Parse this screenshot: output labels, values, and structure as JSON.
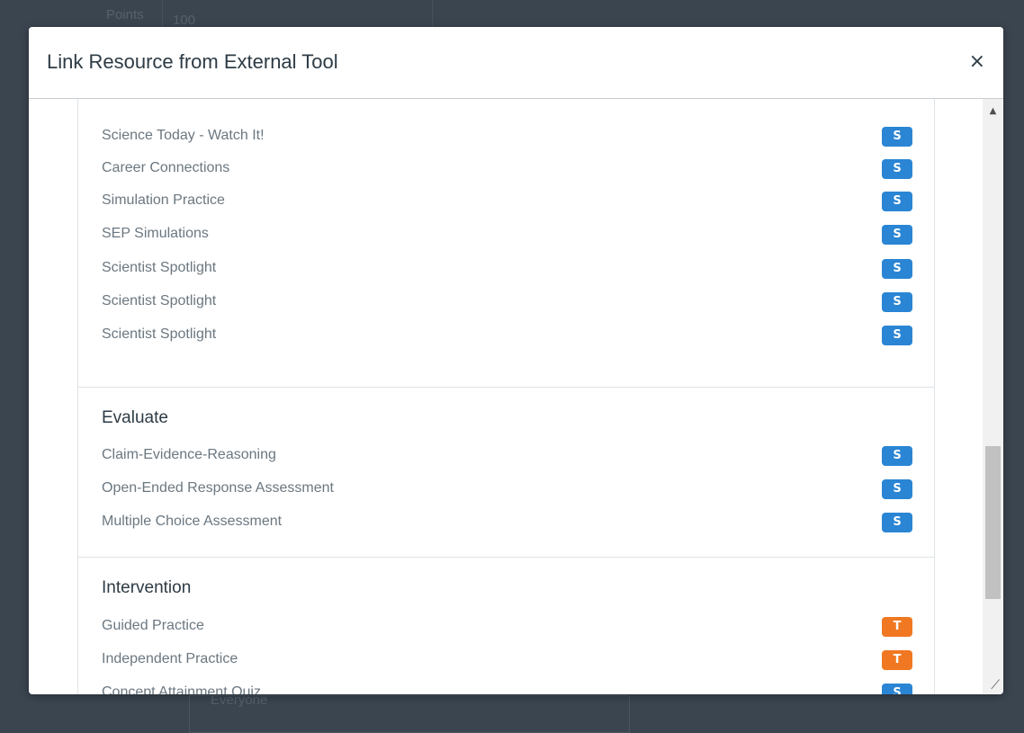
{
  "background": {
    "points_label": "Points",
    "points_value": "100",
    "assign_to_value": "Everyone"
  },
  "modal": {
    "title": "Link Resource from External Tool",
    "close_label": "×"
  },
  "colors": {
    "student_badge": "#2a85d4",
    "teacher_badge": "#f07822"
  },
  "list": {
    "top_items": [
      {
        "label": "Science Today - Watch It!",
        "badge": "S"
      },
      {
        "label": "Career Connections",
        "badge": "S"
      },
      {
        "label": "Simulation Practice",
        "badge": "S"
      },
      {
        "label": "SEP Simulations",
        "badge": "S"
      },
      {
        "label": "Scientist Spotlight",
        "badge": "S"
      },
      {
        "label": "Scientist Spotlight",
        "badge": "S"
      },
      {
        "label": "Scientist Spotlight",
        "badge": "S"
      }
    ],
    "sections": [
      {
        "title": "Evaluate",
        "items": [
          {
            "label": "Claim-Evidence-Reasoning",
            "badge": "S"
          },
          {
            "label": "Open-Ended Response Assessment",
            "badge": "S"
          },
          {
            "label": "Multiple Choice Assessment",
            "badge": "S"
          }
        ]
      },
      {
        "title": "Intervention",
        "items": [
          {
            "label": "Guided Practice",
            "badge": "T"
          },
          {
            "label": "Independent Practice",
            "badge": "T"
          },
          {
            "label": "Concept Attainment Quiz",
            "badge": "S"
          }
        ]
      }
    ]
  },
  "scrollbar": {
    "up_arrow": "▲",
    "resize_grip": "⟋"
  }
}
